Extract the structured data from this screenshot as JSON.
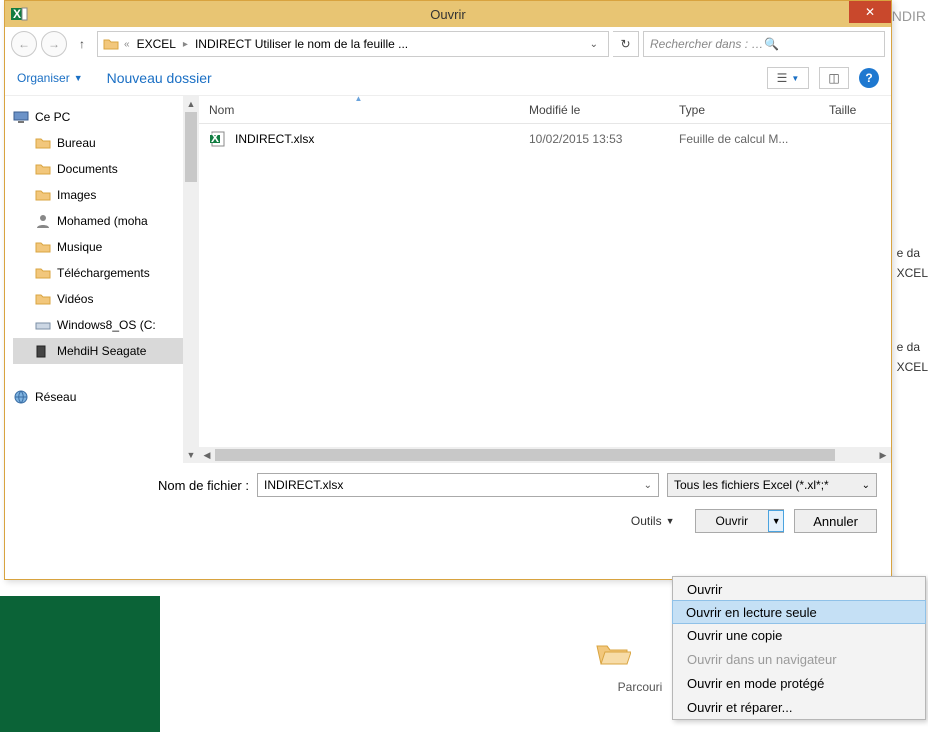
{
  "behind": {
    "corner": "NDIR",
    "r1": "e da",
    "r2": "XCEL",
    "r3": "e da",
    "r4": "XCEL",
    "browse": "Parcouri"
  },
  "dialog": {
    "title": "Ouvrir",
    "breadcrumb": {
      "crumb1": "EXCEL",
      "crumb2": "INDIRECT Utiliser le nom de la feuille ..."
    },
    "search_placeholder": "Rechercher dans : INDIRECT U...",
    "toolbar": {
      "organize": "Organiser",
      "newfolder": "Nouveau dossier"
    },
    "tree": {
      "pc": "Ce PC",
      "items": [
        "Bureau",
        "Documents",
        "Images",
        "Mohamed (moha",
        "Musique",
        "Téléchargements",
        "Vidéos",
        "Windows8_OS (C:",
        "MehdiH Seagate"
      ],
      "network": "Réseau"
    },
    "columns": {
      "name": "Nom",
      "mod": "Modifié le",
      "type": "Type",
      "size": "Taille"
    },
    "file": {
      "name": "INDIRECT.xlsx",
      "mod": "10/02/2015 13:53",
      "type": "Feuille de calcul M..."
    },
    "filename_label": "Nom de fichier :",
    "filename_value": "INDIRECT.xlsx",
    "filetype": "Tous les fichiers Excel (*.xl*;*",
    "tools": "Outils",
    "open": "Ouvrir",
    "cancel": "Annuler"
  },
  "menu": {
    "open": "Ouvrir",
    "readonly": "Ouvrir en lecture seule",
    "copy": "Ouvrir une copie",
    "browser": "Ouvrir dans un navigateur",
    "protected": "Ouvrir en mode protégé",
    "repair": "Ouvrir et réparer..."
  }
}
